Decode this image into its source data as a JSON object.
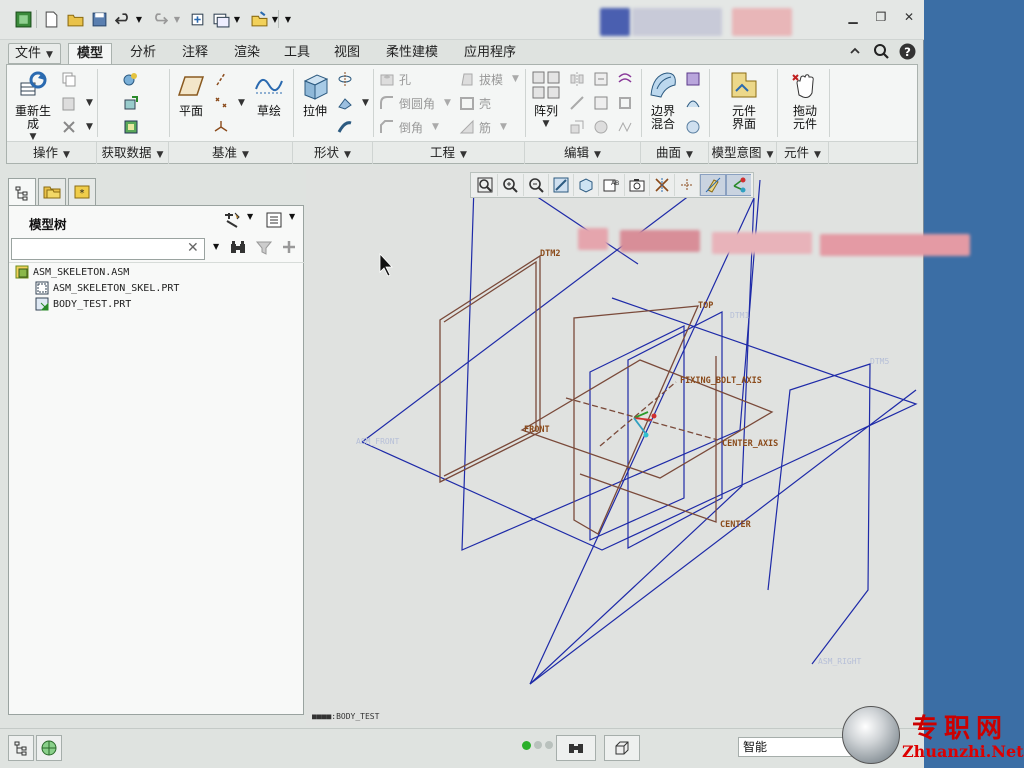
{
  "tabs": {
    "file": "文件",
    "items": [
      "模型",
      "分析",
      "注释",
      "渲染",
      "工具",
      "视图",
      "柔性建模",
      "应用程序"
    ]
  },
  "ribbon": {
    "operations": {
      "regenerate": "重新生\n成"
    },
    "datum": {
      "plane": "平面",
      "sketch": "草绘"
    },
    "shapes": {
      "extrude": "拉伸"
    },
    "engineering": {
      "hole": "孔",
      "round": "倒圆角",
      "chamfer": "倒角",
      "draft": "拔模",
      "shell": "壳",
      "rib": "筋"
    },
    "editing": {
      "pattern": "阵列"
    },
    "surfaces": {
      "boundary_blend": "边界\n混合"
    },
    "model_intent": {
      "component_interface": "元件\n界面"
    },
    "components": {
      "drag_components": "拖动\n元件"
    },
    "group_labels": [
      "操作",
      "获取数据",
      "基准",
      "形状",
      "工程",
      "编辑",
      "曲面",
      "模型意图",
      "元件"
    ]
  },
  "model_tree": {
    "title": "模型树",
    "items": [
      "ASM_SKELETON.ASM",
      "ASM_SKELETON_SKEL.PRT",
      "BODY_TEST.PRT"
    ]
  },
  "viewport": {
    "labels": {
      "dtm2": "DTM2",
      "dtm1": "DTM1",
      "dtm5": "DTM5",
      "top": "TOP",
      "front": "FRONT",
      "asm_front": "ASM_FRONT",
      "asm_right": "ASM_RIGHT",
      "fixing_bolt_axis": "FIXING_BOLT_AXIS",
      "center_axis": "CENTER_AXIS",
      "center": "CENTER"
    },
    "model_name": "BODY_TEST"
  },
  "status": {
    "filter_value": "智能"
  },
  "watermark": {
    "cn": "专职网",
    "en": "Zhuanzhi.Net"
  },
  "colors": {
    "datum_blue": "#1e2aa8",
    "skeleton_brown": "#7a4a3a",
    "label_brown": "#8a4a1a",
    "desktop": "#3b6ea5"
  }
}
